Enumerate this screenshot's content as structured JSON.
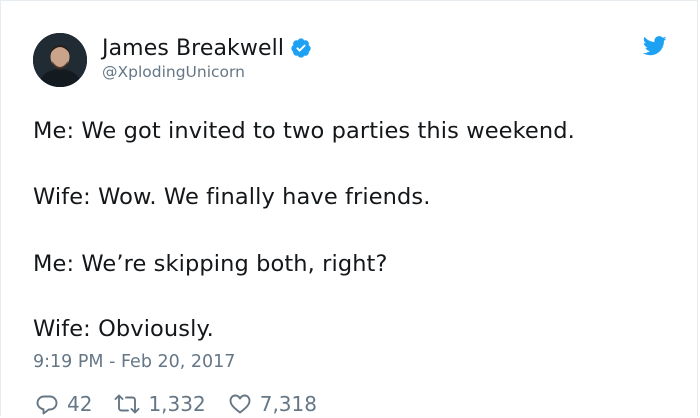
{
  "tweet": {
    "author": {
      "display_name": "James Breakwell",
      "handle": "@XplodingUnicorn",
      "verified": true
    },
    "lines": [
      "Me: We got invited to two parties this weekend.",
      "Wife: Wow. We finally have friends.",
      "Me: We’re skipping both, right?",
      "Wife: Obviously."
    ],
    "timestamp": "9:19 PM - Feb 20, 2017",
    "actions": {
      "replies": "42",
      "retweets": "1,332",
      "likes": "7,318"
    }
  },
  "icons": {
    "brand": "twitter-bird-icon",
    "verified": "verified-badge-icon",
    "reply": "reply-icon",
    "retweet": "retweet-icon",
    "like": "heart-icon"
  },
  "colors": {
    "brand_blue": "#1da1f2",
    "text": "#14171a",
    "muted": "#657786",
    "border": "#e6ecf0"
  }
}
